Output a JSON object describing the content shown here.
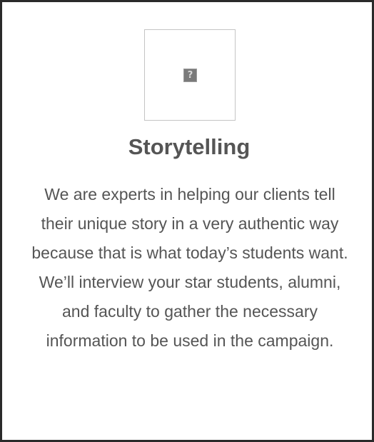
{
  "card": {
    "image_icon": "broken-image-icon",
    "image_glyph": "?",
    "title": "Storytelling",
    "description": "We are experts in helping our clients tell their unique story in a very authentic way because that is what today’s students want. We’ll interview your star students, alumni, and faculty to gather the necessary information to be used in the campaign."
  },
  "colors": {
    "border": "#2a2a2a",
    "text": "#555555",
    "image_frame_border": "#c4c4c4",
    "icon_fill": "#7a7a7a"
  }
}
